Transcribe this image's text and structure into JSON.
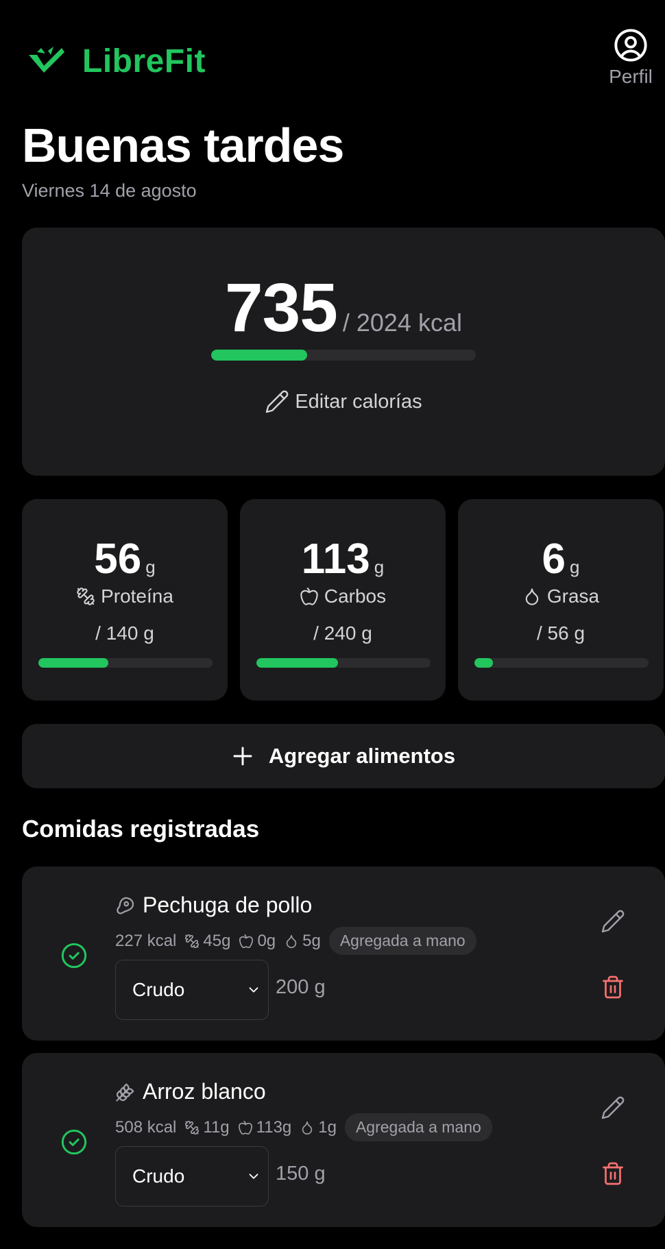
{
  "app": {
    "name": "LibreFit"
  },
  "header": {
    "profile_label": "Perfil"
  },
  "greeting": {
    "title": "Buenas tardes",
    "date": "Viernes 14 de agosto"
  },
  "calories": {
    "consumed": "735",
    "goal_text": "/ 2024 kcal",
    "progress": 0.363,
    "edit_label": "Editar calorías"
  },
  "macros": [
    {
      "value": "56",
      "unit": "g",
      "name": "Proteína",
      "goal": "/ 140 g",
      "progress": 0.4,
      "icon": "dumbbell-icon"
    },
    {
      "value": "113",
      "unit": "g",
      "name": "Carbos",
      "goal": "/ 240 g",
      "progress": 0.47,
      "icon": "apple-icon"
    },
    {
      "value": "6",
      "unit": "g",
      "name": "Grasa",
      "goal": "/ 56 g",
      "progress": 0.107,
      "icon": "drop-icon"
    }
  ],
  "actions": {
    "add_food_label": "Agregar alimentos"
  },
  "section": {
    "title": "Comidas registradas"
  },
  "meals": [
    {
      "name": "Pechuga de pollo",
      "icon": "meat-icon",
      "kcal": "227 kcal",
      "protein": "45g",
      "carbs": "0g",
      "fat": "5g",
      "tag": "Agregada a mano",
      "preparation": "Crudo",
      "weight": "200 g"
    },
    {
      "name": "Arroz blanco",
      "icon": "wheat-icon",
      "kcal": "508 kcal",
      "protein": "11g",
      "carbs": "113g",
      "fat": "1g",
      "tag": "Agregada a mano",
      "preparation": "Crudo",
      "weight": "150 g"
    }
  ],
  "colors": {
    "accent": "#22c55e",
    "card": "#1c1c1e",
    "muted": "#a1a1aa",
    "danger": "#f87171"
  }
}
